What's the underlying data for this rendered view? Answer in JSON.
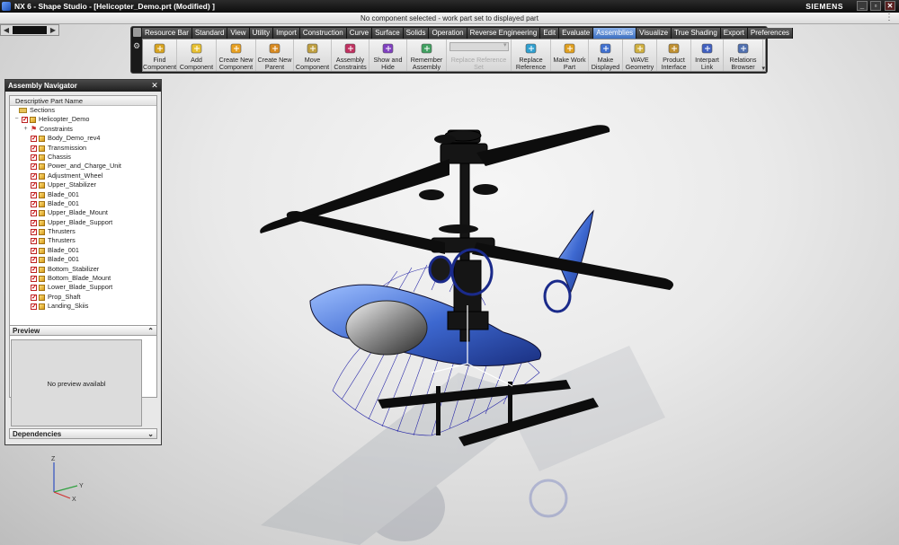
{
  "window": {
    "title": "NX 6 - Shape Studio - [Helicopter_Demo.prt (Modified) ]",
    "brand": "SIEMENS",
    "controls": [
      "_",
      "▫",
      "✕"
    ]
  },
  "status_message": "No component selected - work part set to displayed part",
  "ribbon": {
    "tabs": [
      {
        "label": "Resource Bar",
        "active": false
      },
      {
        "label": "Standard",
        "active": false
      },
      {
        "label": "View",
        "active": false
      },
      {
        "label": "Utility",
        "active": false
      },
      {
        "label": "Import",
        "active": false
      },
      {
        "label": "Construction",
        "active": false
      },
      {
        "label": "Curve",
        "active": false
      },
      {
        "label": "Surface",
        "active": false
      },
      {
        "label": "Solids",
        "active": false
      },
      {
        "label": "Operation",
        "active": false
      },
      {
        "label": "Reverse Engineering",
        "active": false
      },
      {
        "label": "Edit",
        "active": false
      },
      {
        "label": "Evaluate",
        "active": false
      },
      {
        "label": "Assemblies",
        "active": true
      },
      {
        "label": "Visualize",
        "active": false
      },
      {
        "label": "True Shading",
        "active": false
      },
      {
        "label": "Export",
        "active": false
      },
      {
        "label": "Preferences",
        "active": false
      }
    ],
    "buttons": [
      {
        "line1": "Find",
        "line2": "Component",
        "icon": "find-component-icon",
        "enabled": true
      },
      {
        "line1": "Add",
        "line2": "Component",
        "icon": "add-component-icon",
        "enabled": true
      },
      {
        "line1": "Create New",
        "line2": "Component",
        "icon": "create-new-component-icon",
        "enabled": true
      },
      {
        "line1": "Create New",
        "line2": "Parent",
        "icon": "create-new-parent-icon",
        "enabled": true
      },
      {
        "line1": "Move",
        "line2": "Component",
        "icon": "move-component-icon",
        "enabled": true
      },
      {
        "line1": "Assembly",
        "line2": "Constraints",
        "icon": "assembly-constraints-icon",
        "enabled": true
      },
      {
        "line1": "Show and",
        "line2": "Hide",
        "icon": "show-and-hide-icon",
        "enabled": true
      },
      {
        "line1": "Remember",
        "line2": "Assembly",
        "icon": "remember-assembly-icon",
        "enabled": true
      },
      {
        "line1": "Replace Reference",
        "line2": "Set",
        "icon": "replace-reference-set-combo",
        "enabled": false
      },
      {
        "line1": "Replace",
        "line2": "Reference",
        "icon": "replace-reference-icon",
        "enabled": true
      },
      {
        "line1": "Make Work",
        "line2": "Part",
        "icon": "make-work-part-icon",
        "enabled": true
      },
      {
        "line1": "Make",
        "line2": "Displayed",
        "icon": "make-displayed-icon",
        "enabled": true
      },
      {
        "line1": "WAVE",
        "line2": "Geometry",
        "icon": "wave-geometry-icon",
        "enabled": true
      },
      {
        "line1": "Product",
        "line2": "Interface",
        "icon": "product-interface-icon",
        "enabled": true
      },
      {
        "line1": "Interpart",
        "line2": "Link",
        "icon": "interpart-link-icon",
        "enabled": true
      },
      {
        "line1": "Relations",
        "line2": "Browser",
        "icon": "relations-browser-icon",
        "enabled": true
      }
    ]
  },
  "navigator": {
    "title": "Assembly Navigator",
    "column_header": "Descriptive Part Name",
    "tree": [
      {
        "label": "Sections",
        "level": 0,
        "type": "folder",
        "expander": "",
        "checked": false
      },
      {
        "label": "Helicopter_Demo",
        "level": 0,
        "type": "part",
        "expander": "−",
        "checked": true
      },
      {
        "label": "Constraints",
        "level": 1,
        "type": "constraints",
        "expander": "+",
        "checked": false
      },
      {
        "label": "Body_Demo_rev4",
        "level": 1,
        "type": "part",
        "expander": "",
        "checked": true
      },
      {
        "label": "Transmission",
        "level": 1,
        "type": "part",
        "expander": "",
        "checked": true
      },
      {
        "label": "Chassis",
        "level": 1,
        "type": "part",
        "expander": "",
        "checked": true
      },
      {
        "label": "Power_and_Charge_Unit",
        "level": 1,
        "type": "part",
        "expander": "",
        "checked": true
      },
      {
        "label": "Adjustment_Wheel",
        "level": 1,
        "type": "part",
        "expander": "",
        "checked": true
      },
      {
        "label": "Upper_Stabilizer",
        "level": 1,
        "type": "part",
        "expander": "",
        "checked": true
      },
      {
        "label": "Blade_001",
        "level": 1,
        "type": "part",
        "expander": "",
        "checked": true
      },
      {
        "label": "Blade_001",
        "level": 1,
        "type": "part",
        "expander": "",
        "checked": true
      },
      {
        "label": "Upper_Blade_Mount",
        "level": 1,
        "type": "part",
        "expander": "",
        "checked": true
      },
      {
        "label": "Upper_Blade_Support",
        "level": 1,
        "type": "part",
        "expander": "",
        "checked": true
      },
      {
        "label": "Thrusters",
        "level": 1,
        "type": "part",
        "expander": "",
        "checked": true
      },
      {
        "label": "Thrusters",
        "level": 1,
        "type": "part",
        "expander": "",
        "checked": true
      },
      {
        "label": "Blade_001",
        "level": 1,
        "type": "part",
        "expander": "",
        "checked": true
      },
      {
        "label": "Blade_001",
        "level": 1,
        "type": "part",
        "expander": "",
        "checked": true
      },
      {
        "label": "Bottom_Stabilizer",
        "level": 1,
        "type": "part",
        "expander": "",
        "checked": true
      },
      {
        "label": "Bottom_Blade_Mount",
        "level": 1,
        "type": "part",
        "expander": "",
        "checked": true
      },
      {
        "label": "Lower_Blade_Support",
        "level": 1,
        "type": "part",
        "expander": "",
        "checked": true
      },
      {
        "label": "Prop_Shaft",
        "level": 1,
        "type": "part",
        "expander": "",
        "checked": true
      },
      {
        "label": "Landing_Skiis",
        "level": 1,
        "type": "part",
        "expander": "",
        "checked": true
      }
    ],
    "preview_title": "Preview",
    "preview_text": "No preview availabl",
    "dependencies_title": "Dependencies"
  },
  "triad_labels": {
    "z": "Z",
    "y": "Y",
    "x": "X"
  },
  "colors": {
    "accent": "#3b6fc0",
    "model_blue": "#4a78d8",
    "wire": "#2a2aa8"
  }
}
